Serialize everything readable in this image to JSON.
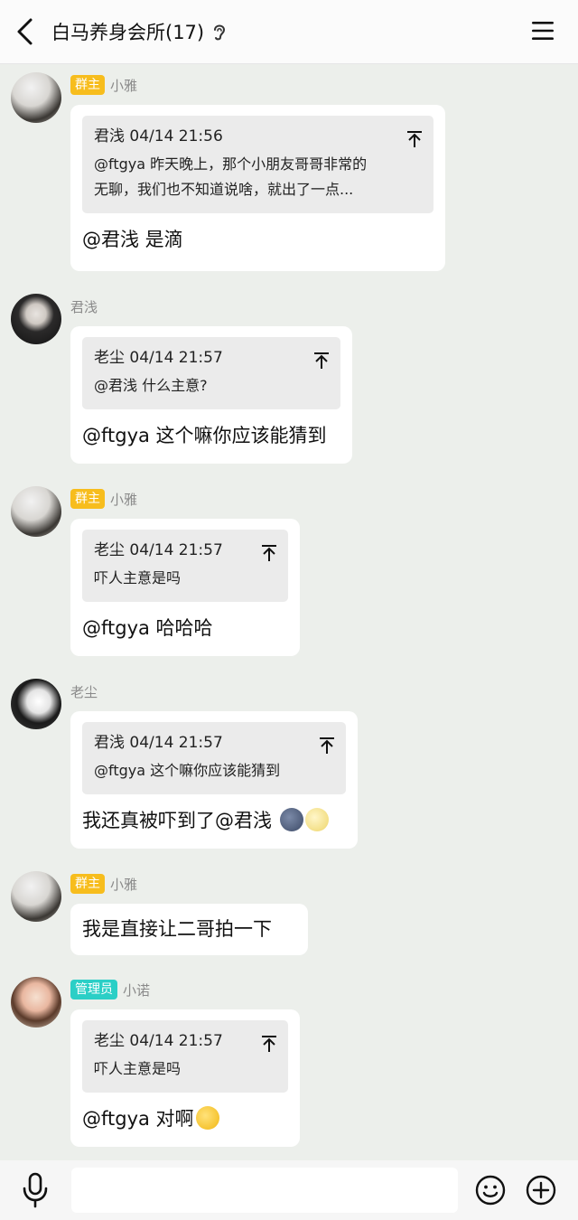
{
  "header": {
    "title": "白马养身会所(17)"
  },
  "messages": [
    {
      "badge": "群主",
      "sender": "小雅",
      "quote": {
        "head": "君浅 04/14 21:56",
        "lines": [
          "@ftgya 昨天晚上，那个小朋友哥哥非常的",
          "无聊，我们也不知道说啥，就出了一点..."
        ]
      },
      "text": "@君浅 是滴"
    },
    {
      "badge": "",
      "sender": "君浅",
      "quote": {
        "head": "老尘 04/14 21:57",
        "lines": [
          "@君浅 什么主意?"
        ]
      },
      "text": "@ftgya 这个嘛你应该能猜到"
    },
    {
      "badge": "群主",
      "sender": "小雅",
      "quote": {
        "head": "老尘 04/14 21:57",
        "lines": [
          "吓人主意是吗"
        ]
      },
      "text": "@ftgya 哈哈哈"
    },
    {
      "badge": "",
      "sender": "老尘",
      "quote": {
        "head": "君浅 04/14 21:57",
        "lines": [
          "@ftgya 这个嘛你应该能猜到"
        ]
      },
      "text": "我还真被吓到了@君浅 "
    },
    {
      "badge": "群主",
      "sender": "小雅",
      "text": "我是直接让二哥拍一下"
    },
    {
      "badge": "管理员",
      "sender": "小诺",
      "quote": {
        "head": "老尘 04/14 21:57",
        "lines": [
          "吓人主意是吗"
        ]
      },
      "text": "@ftgya 对啊"
    }
  ],
  "icons": {
    "back": "chevron-left-icon",
    "ear": "ear-icon",
    "menu": "hamburger-menu-icon",
    "pin": "jump-to-top-icon",
    "mic": "microphone-icon",
    "emoji": "smiley-icon",
    "plus": "plus-circle-icon"
  },
  "colors": {
    "owner_badge": "#f7bd1d",
    "admin_badge": "#2bcfc6",
    "background": "#ecefeb"
  }
}
